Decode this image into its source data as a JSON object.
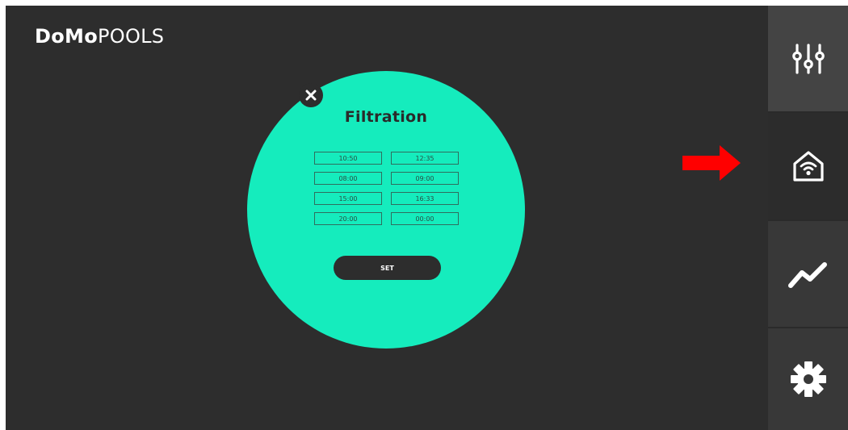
{
  "brand": {
    "bold": "DoMo",
    "light": "POOLS"
  },
  "modal": {
    "title": "Filtration",
    "slots": [
      [
        "10:50",
        "12:35"
      ],
      [
        "08:00",
        "09:00"
      ],
      [
        "15:00",
        "16:33"
      ],
      [
        "20:00",
        "00:00"
      ]
    ],
    "set_label": "SET",
    "accent_color": "#15ecbd"
  },
  "sidebar": {
    "items": [
      {
        "icon": "sliders-icon",
        "active": false
      },
      {
        "icon": "home-wifi-icon",
        "active": true
      },
      {
        "icon": "trend-chart-icon",
        "active": false
      },
      {
        "icon": "gear-icon",
        "active": false
      }
    ]
  },
  "annotation": {
    "icon": "right-arrow-icon",
    "color": "#ff0000"
  }
}
